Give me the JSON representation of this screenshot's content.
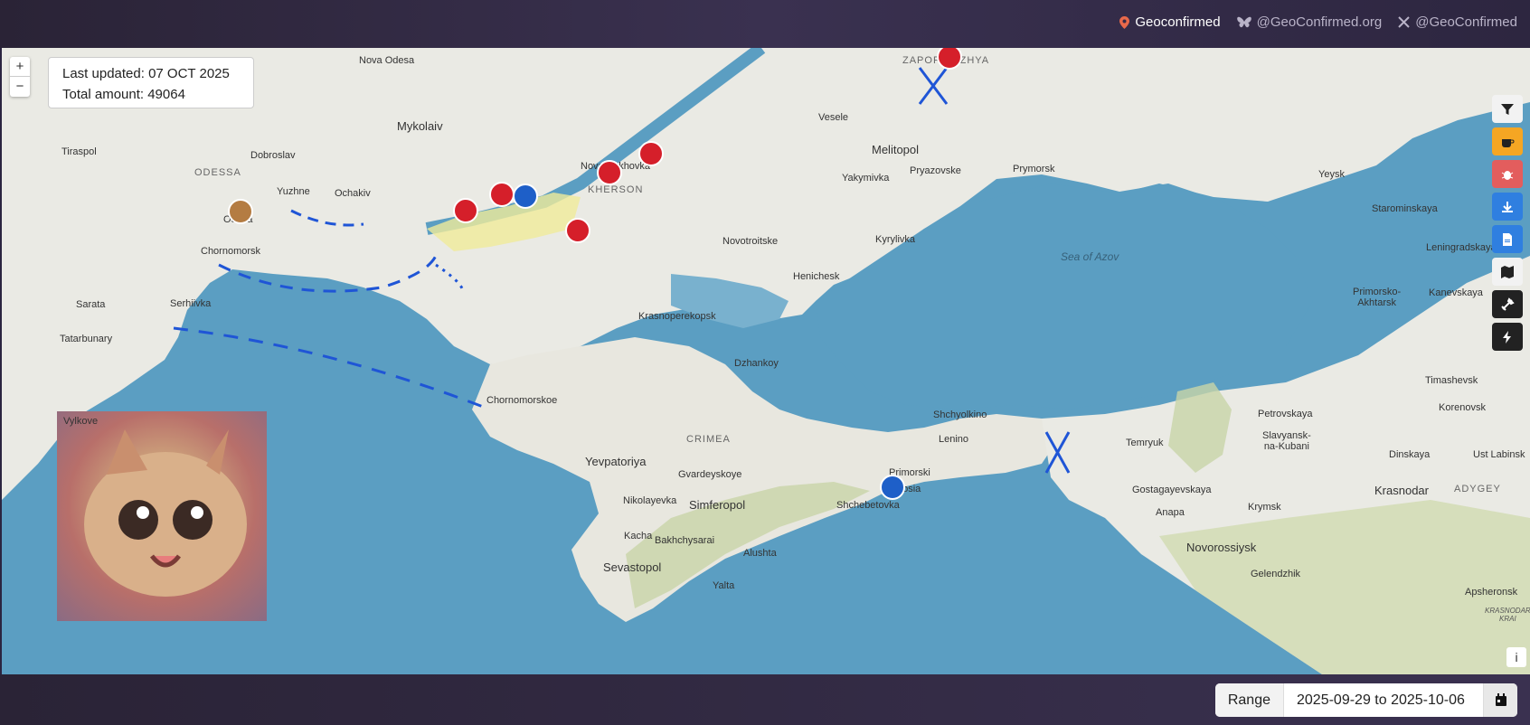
{
  "header": {
    "brand": "Geoconfirmed",
    "bluesky": "@GeoConfirmed.org",
    "x_handle": "@GeoConfirmed",
    "brand_icon": "map-pin-icon",
    "bluesky_icon": "butterfly-icon",
    "x_icon": "x-logo-icon"
  },
  "map": {
    "zoom_in": "+",
    "zoom_out": "−",
    "last_updated": "Last updated: 07 OCT 2025",
    "total_amount": "Total amount: 49064",
    "info_button": "i",
    "tools": [
      {
        "icon": "filter-icon",
        "color": "#f2f2f2"
      },
      {
        "icon": "coffee-icon",
        "color": "#f5a623"
      },
      {
        "icon": "bug-icon",
        "color": "#e35d5d"
      },
      {
        "icon": "download-icon",
        "color": "#2f7fe0"
      },
      {
        "icon": "document-icon",
        "color": "#2f7fe0"
      },
      {
        "icon": "map-icon",
        "color": "#f2f2f2"
      },
      {
        "icon": "tools-icon",
        "color": "#222222"
      },
      {
        "icon": "lightning-icon",
        "color": "#222222"
      }
    ],
    "places": {
      "odessa": "ODESSA",
      "odesa": "Odesa",
      "tiraspol": "Tiraspol",
      "dobroslav": "Dobroslav",
      "yuzhne": "Yuzhne",
      "ochakiv": "Ochakiv",
      "mykolaiv": "Mykolaiv",
      "nova_odesa": "Nova Odesa",
      "kherson": "KHERSON",
      "nova_kakhovka": "Nova Kakhovka",
      "zaporizhzhia": "ZAPORIZHZHYA",
      "melitopol": "Melitopol",
      "veselе": "Vesele",
      "yakymivka": "Yakymivka",
      "pryazovske": "Pryazovske",
      "prymorsk": "Prymorsk",
      "kyrylivka": "Kyrylivka",
      "novotroitske": "Novotroitske",
      "henichesk": "Henichesk",
      "krasnoperekopsk": "Krasnoperekopsk",
      "dzhankoy": "Dzhankoy",
      "crimea": "CRIMEA",
      "chornomorske": "Chornomorskoe",
      "yevpatoriya": "Yevpatoriya",
      "gvardeyskoye": "Gvardeyskoye",
      "nikolayevka": "Nikolayevka",
      "simferopol": "Simferopol",
      "bakhchysarai": "Bakhchysarai",
      "kacha": "Kacha",
      "sevastopol": "Sevastopol",
      "yalta": "Yalta",
      "alushta": "Alushta",
      "feodosia": "Feodosia",
      "primorski": "Primorski",
      "shchebetovka": "Shchebetovka",
      "shcholkino": "Shchyolkino",
      "lenino": "Lenino",
      "temryuk": "Temryuk",
      "gostagayevskaya": "Gostagayevskaya",
      "anapa": "Anapa",
      "novorossiysk": "Novorossiysk",
      "gelendzhik": "Gelendzhik",
      "krymsk": "Krymsk",
      "krasnodar": "Krasnodar",
      "adygey": "ADYGEY",
      "slavyansk": "Slavyansk-\nna-Kubani",
      "petrovskaya": "Petrovskaya",
      "timashevsk": "Timashevsk",
      "korenovsk": "Korenovsk",
      "dinskaya": "Dinskaya",
      "ust_labinsk": "Ust Labinsk",
      "kanevskaya": "Kanevskaya",
      "leningradskaya": "Leningradskaya",
      "starominskaya": "Starominskaya",
      "yeysk": "Yeysk",
      "primorsko": "Primorsko-\nAkhtarsk",
      "chornomorsk": "Chornomorsk",
      "sarata": "Sarata",
      "serhiivka": "Serhiivka",
      "tatarbunary": "Tatarbunary",
      "vylkove": "Vylkove",
      "sea_azov": "Sea of Azov",
      "krasnodar_krai": "KRASNODAR\nKRAI",
      "apsheronsk": "Apsheronsk"
    }
  },
  "footer": {
    "range_label": "Range",
    "range_value": "2025-09-29 to 2025-10-06",
    "calendar_icon": "calendar-icon"
  }
}
